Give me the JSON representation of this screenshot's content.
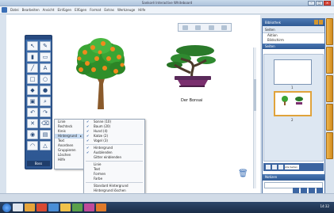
{
  "window": {
    "title": "Sankoré Interactive Whiteboard"
  },
  "menubar": {
    "items": [
      "Datei",
      "Bearbeiten",
      "Ansicht",
      "Einfügen",
      "Eifügen",
      "Format",
      "Extras",
      "Werkzeuge",
      "Hilfe"
    ]
  },
  "canvas": {
    "bonsai_caption": "Der Bonsai"
  },
  "toolbar": {
    "footer_label": "Boss"
  },
  "context_menu_1": {
    "items": [
      "Linie",
      "Rechteck",
      "Kreis",
      "Hintergrund",
      "Text",
      "Anordnen",
      "Gruppieren",
      "Löschen",
      "Hilfe"
    ],
    "selected_index": 3
  },
  "context_menu_2": {
    "items": [
      {
        "label": "Sonne (10)",
        "checked": true
      },
      {
        "label": "Baum (20)",
        "checked": true
      },
      {
        "label": "Hund (4)",
        "checked": true
      },
      {
        "label": "Katze (2)",
        "checked": true
      },
      {
        "label": "Vogel (3)",
        "checked": true
      },
      {
        "label": "Hintergrund",
        "checked": true
      },
      {
        "label": "Ausblenden",
        "checked": true
      },
      {
        "label": "Gitter einblenden",
        "checked": false
      },
      {
        "label": "Linie",
        "checked": false
      },
      {
        "label": "Text",
        "checked": false
      },
      {
        "label": "Formen",
        "checked": false
      },
      {
        "label": "Farbe",
        "checked": false
      },
      {
        "label": "Standard Hintergrund",
        "checked": false
      },
      {
        "label": "Hintergrund löschen",
        "checked": false
      }
    ]
  },
  "right_panel": {
    "title": "Bibliothek",
    "subtitle": "Seiten",
    "options": [
      "Aktion",
      "Bildschirm"
    ],
    "section_title": "Seiten",
    "slide_numbers": [
      "1",
      "2"
    ],
    "bar_select": "Alle Seiten",
    "bottom_section": "Notizen"
  },
  "taskbar": {
    "clock": "14:32"
  },
  "colors": {
    "accent": "#2f5a94",
    "tab": "#efb54b"
  }
}
